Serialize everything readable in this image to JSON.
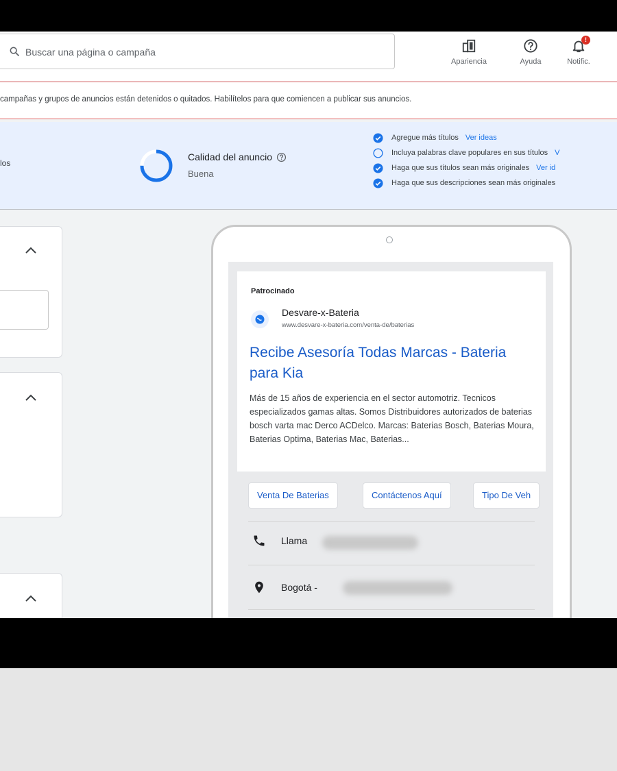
{
  "header": {
    "search": {
      "placeholder": "Buscar una página o campaña"
    },
    "tools": [
      {
        "label": "Apariencia",
        "icon": "appearance-icon"
      },
      {
        "label": "Ayuda",
        "icon": "help-icon"
      },
      {
        "label": "Notific.",
        "icon": "notifications-icon",
        "badge": "!"
      }
    ]
  },
  "alert": {
    "text": "campañas y grupos de anuncios están detenidos o quitados. Habilítelos para que comiencen a publicar sus anuncios."
  },
  "ad_quality": {
    "left_fragment": "los",
    "title": "Calidad del anuncio",
    "value": "Buena",
    "progress": 0.75,
    "tips": [
      {
        "text": "Agregue más títulos",
        "link": "Ver ideas",
        "done": true
      },
      {
        "text": "Incluya palabras clave populares en sus títulos",
        "link": "V",
        "done": false
      },
      {
        "text": "Haga que sus títulos sean más originales",
        "link": "Ver id",
        "done": true
      },
      {
        "text": "Haga que sus descripciones sean más originales",
        "link": "",
        "done": true
      }
    ]
  },
  "preview": {
    "sponsored": "Patrocinado",
    "site_name": "Desvare-x-Bateria",
    "site_url": "www.desvare-x-bateria.com/venta-de/baterias",
    "headline": "Recibe Asesoría Todas Marcas - Bateria para Kia",
    "description": "Más de 15 años de experiencia en el sector automotriz. Tecnicos especializados gamas altas. Somos Distribuidores autorizados de baterias bosch varta mac Derco ACDelco. Marcas: Baterias Bosch, Baterias Moura, Baterias Optima, Baterias Mac, Baterias...",
    "sitelinks": [
      "Venta De Baterias",
      "Contáctenos Aquí",
      "Tipo De Veh"
    ],
    "call_label": "Llama",
    "location_label": "Bogotá -"
  },
  "colors": {
    "link": "#1a73e8",
    "headline": "#1a5cc8",
    "alert_border": "#e06060",
    "quality_bg": "#e8f0fe",
    "check": "#1a73e8"
  }
}
